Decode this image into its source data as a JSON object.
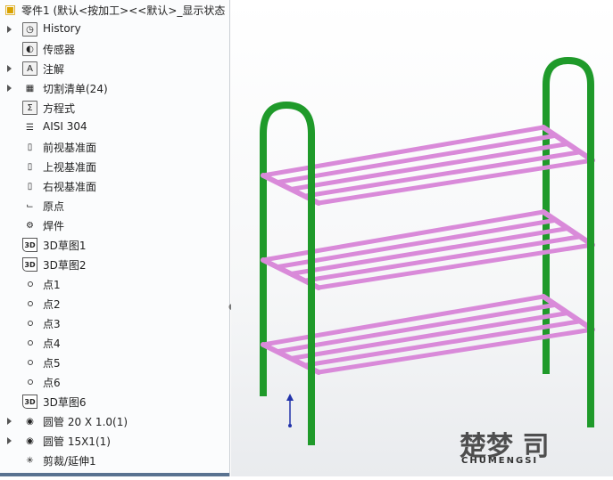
{
  "tree": {
    "title": "零件1  (默认<按加工><<默认>_显示状态",
    "items": [
      {
        "label": "History",
        "icon": "history-folder-icon",
        "expand": true
      },
      {
        "label": "传感器",
        "icon": "sensor-folder-icon",
        "expand": false
      },
      {
        "label": "注解",
        "icon": "annotation-folder-icon",
        "expand": true
      },
      {
        "label": "切割清单(24)",
        "icon": "cut-list-icon",
        "expand": true
      },
      {
        "label": "方程式",
        "icon": "equation-folder-icon",
        "expand": false
      },
      {
        "label": "AISI 304",
        "icon": "material-icon",
        "expand": false
      },
      {
        "label": "前视基准面",
        "icon": "plane-icon",
        "expand": false
      },
      {
        "label": "上视基准面",
        "icon": "plane-icon",
        "expand": false
      },
      {
        "label": "右视基准面",
        "icon": "plane-icon",
        "expand": false
      },
      {
        "label": "原点",
        "icon": "origin-icon",
        "expand": false
      },
      {
        "label": "焊件",
        "icon": "weldment-icon",
        "expand": false
      },
      {
        "label": "3D草图1",
        "icon": "sketch-3d-icon",
        "expand": false
      },
      {
        "label": "3D草图2",
        "icon": "sketch-3d-icon",
        "expand": false
      },
      {
        "label": "点1",
        "icon": "point-icon",
        "expand": false
      },
      {
        "label": "点2",
        "icon": "point-icon",
        "expand": false
      },
      {
        "label": "点3",
        "icon": "point-icon",
        "expand": false
      },
      {
        "label": "点4",
        "icon": "point-icon",
        "expand": false
      },
      {
        "label": "点5",
        "icon": "point-icon",
        "expand": false
      },
      {
        "label": "点6",
        "icon": "point-icon",
        "expand": false
      },
      {
        "label": "3D草图6",
        "icon": "sketch-3d-icon",
        "expand": false
      },
      {
        "label": "圆管 20 X 1.0(1)",
        "icon": "structural-member-icon",
        "expand": true
      },
      {
        "label": "圆管 15X1(1)",
        "icon": "structural-member-icon",
        "expand": true
      },
      {
        "label": "剪裁/延伸1",
        "icon": "trim-extend-icon",
        "expand": false
      }
    ]
  },
  "watermark": {
    "logo": "楚梦",
    "logo_sub": "CHUMENGSI"
  },
  "colors": {
    "frame": "#1f9a2a",
    "shelf": "#d98ad9"
  }
}
